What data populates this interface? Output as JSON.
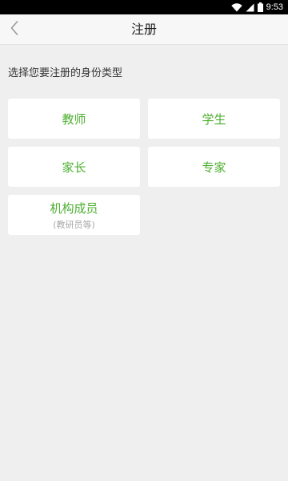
{
  "status_bar": {
    "time": "9:53",
    "icons": [
      "wifi-icon",
      "cellular-signal-icon",
      "battery-icon"
    ]
  },
  "nav": {
    "title": "注册",
    "back_icon": "chevron-left-icon"
  },
  "prompt": "选择您要注册的身份类型",
  "options": [
    {
      "label": "教师"
    },
    {
      "label": "学生"
    },
    {
      "label": "家长"
    },
    {
      "label": "专家"
    },
    {
      "label": "机构成员",
      "sublabel": "(教研员等)"
    }
  ],
  "colors": {
    "accent": "#4caf2f",
    "sublabel": "#a8a8a8",
    "background": "#efefef",
    "card": "#ffffff",
    "status_bar": "#000000"
  }
}
